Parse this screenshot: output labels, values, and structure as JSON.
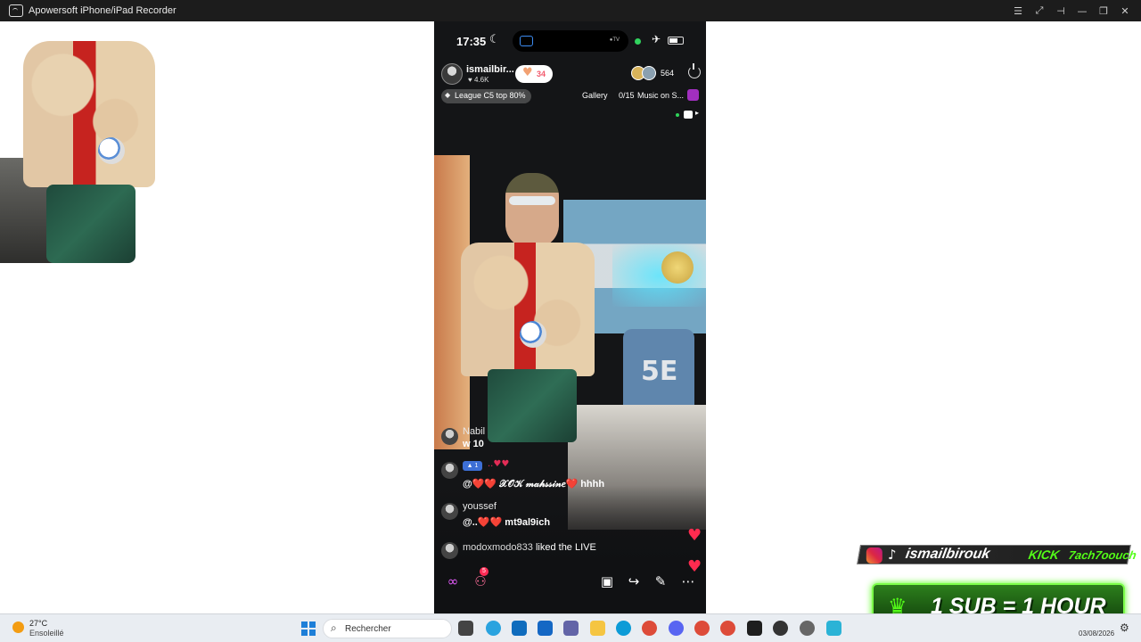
{
  "window": {
    "title": "Apowersoft iPhone/iPad Recorder"
  },
  "phone": {
    "status": {
      "time": "17:35"
    },
    "live": {
      "host_name": "ismailbir...",
      "host_likes": "4.6K",
      "like_count": "34",
      "viewer_count": "564",
      "league": "League C5 top 80%",
      "gallery_label": "Gallery",
      "gallery_count": "0/15",
      "music_label": "Music on S..."
    },
    "scene": {
      "jersey_number": "5E"
    },
    "chat": [
      {
        "user": "Nabil",
        "text": "w 10"
      },
      {
        "badge": "1",
        "text": "@❤️❤️ 𝒳𝒪𝒦 𝓂𝒶𝒽𝓈𝓈𝒾𝓃𝑒❤️ hhhh"
      },
      {
        "user": "youssef",
        "text": "@..❤️❤️ mt9al9ich"
      },
      {
        "user": "modoxmodo833",
        "text": "liked the LIVE"
      }
    ],
    "bottom_bar": {
      "notification_count": "5"
    }
  },
  "overlay": {
    "social_handle": "ismailbirouk",
    "kick_label": "KICK",
    "kick_name": "7ach7oouch",
    "sub_banner": "1 SUB = 1 HOUR"
  },
  "taskbar": {
    "weather_temp": "27°C",
    "weather_desc": "Ensoleillé",
    "search_placeholder": "Rechercher",
    "date": "03/08/2026"
  }
}
